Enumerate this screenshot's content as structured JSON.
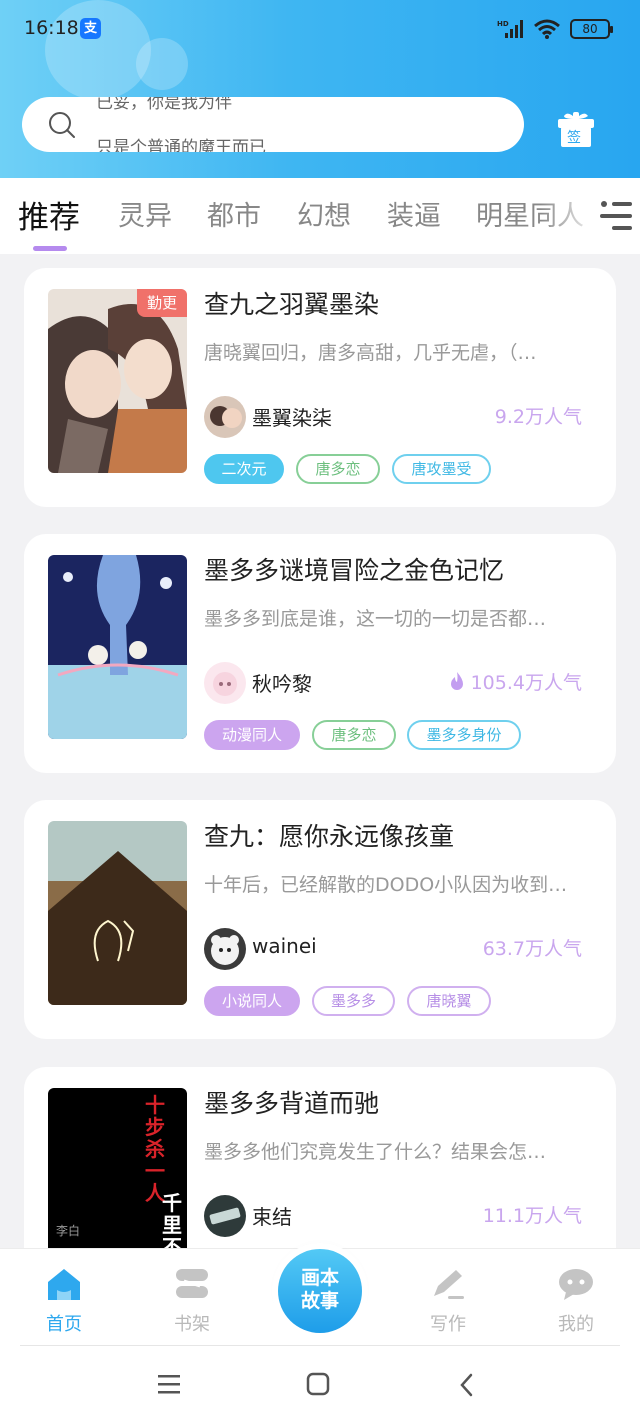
{
  "status_bar": {
    "time": "16:18",
    "alipay_badge": "支",
    "battery": "80",
    "icons": [
      "hd-signal-icon",
      "wifi-icon",
      "battery-icon"
    ]
  },
  "search": {
    "line1": "已妥，你是我为伴",
    "line2": "只是个普通的魔王而已",
    "icon": "search-icon"
  },
  "gift": {
    "label": "签",
    "icon": "gift-sign-in-icon"
  },
  "tabs": [
    "推荐",
    "灵异",
    "都市",
    "幻想",
    "装逼",
    "明星同人"
  ],
  "colors": {
    "accent_blue": "#2ea8ee",
    "tab_underline": "#b58aee",
    "popularity": "#c9a6ee",
    "badge_red": "#f0716a"
  },
  "cards": [
    {
      "title": "查九之羽翼墨染",
      "desc": "唐晓翼回归，唐多高甜，几乎无虐，（…",
      "author": "墨翼染柒",
      "popularity": "9.2万人气",
      "badge": "勤更",
      "tags": [
        "二次元",
        "唐多恋",
        "唐攻墨受"
      ]
    },
    {
      "title": "墨多多谜境冒险之金色记忆",
      "desc": "墨多多到底是谁，这一切的一切是否都…",
      "author": "秋吟黎",
      "popularity": "105.4万人气",
      "tags": [
        "动漫同人",
        "唐多恋",
        "墨多多身份"
      ]
    },
    {
      "title": "查九：愿你永远像孩童",
      "desc": "十年后，已经解散的DODO小队因为收到…",
      "author": "wainei",
      "popularity": "63.7万人气",
      "tags": [
        "小说同人",
        "墨多多",
        "唐晓翼"
      ]
    },
    {
      "title": "墨多多背道而驰",
      "desc": "墨多多他们究竟发生了什么？结果会怎…",
      "author": "束结",
      "popularity": "11.1万人气",
      "cover_text": {
        "vertical_red": "十步杀一人",
        "vertical_white": "千里不留",
        "corner": "李白"
      }
    }
  ],
  "bottom_nav": {
    "items": [
      "首页",
      "书架",
      "写作",
      "我的"
    ],
    "center_button_line1": "画本",
    "center_button_line2": "故事"
  }
}
